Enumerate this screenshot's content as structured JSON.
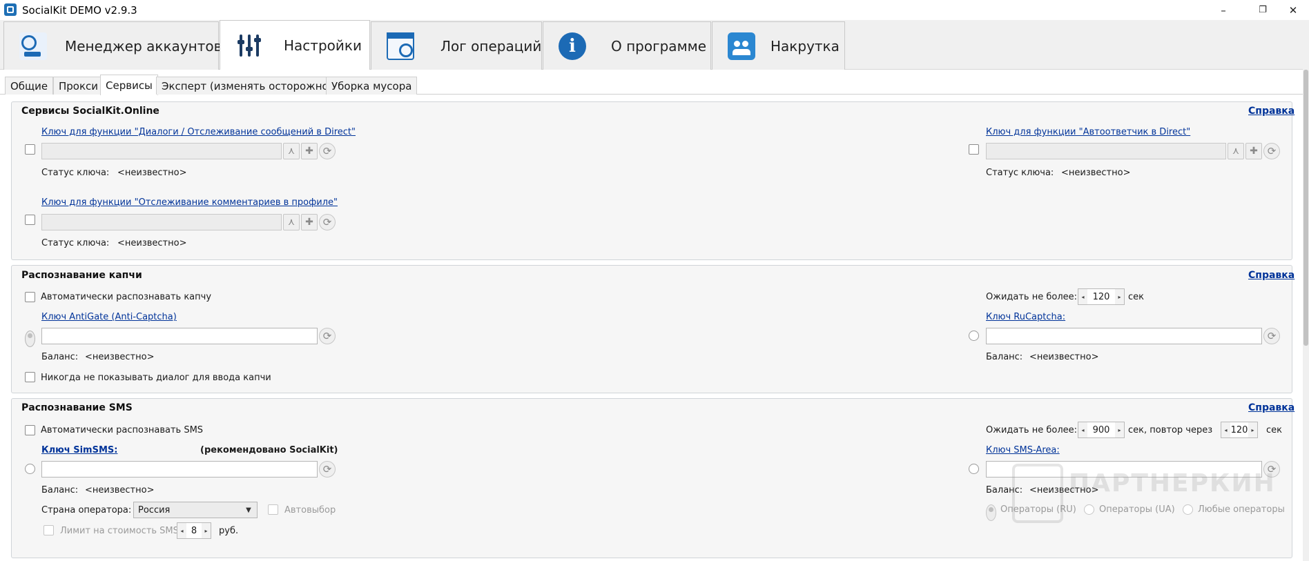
{
  "window": {
    "title": "SocialKit DEMO v2.9.3",
    "min_icon": "–",
    "max_icon": "❐",
    "close_icon": "✕"
  },
  "main_tabs": [
    {
      "label": "Менеджер аккаунтов",
      "icon": "account-manager-icon"
    },
    {
      "label": "Настройки",
      "icon": "settings-sliders-icon",
      "active": true
    },
    {
      "label": "Лог операций",
      "icon": "operations-log-icon"
    },
    {
      "label": "О программе",
      "icon": "info-icon",
      "glyph": "i"
    },
    {
      "label": "Накрутка",
      "icon": "boost-users-icon"
    }
  ],
  "sub_tabs": [
    {
      "label": "Общие"
    },
    {
      "label": "Прокси"
    },
    {
      "label": "Сервисы",
      "active": true
    },
    {
      "label": "Эксперт (изменять осторожно)"
    },
    {
      "label": "Уборка мусора"
    }
  ],
  "services": {
    "title": "Сервисы SocialKit.Online",
    "help": "Справка",
    "dialogs_key": {
      "label": "Ключ для функции \"Диалоги / Отслеживание сообщений в Direct\"",
      "status_label": "Статус ключа:",
      "status_value": "<неизвестно>"
    },
    "autoresponder_key": {
      "label": "Ключ для функции \"Автоответчик в Direct\"",
      "status_label": "Статус ключа:",
      "status_value": "<неизвестно>"
    },
    "comments_key": {
      "label": "Ключ для функции \"Отслеживание комментариев в профиле\"",
      "status_label": "Статус ключа:",
      "status_value": "<неизвестно>"
    }
  },
  "captcha": {
    "title": "Распознавание капчи",
    "help": "Справка",
    "auto_label": "Автоматически распознавать капчу",
    "wait_label": "Ожидать не более:",
    "wait_value": "120",
    "wait_unit": "сек",
    "antigate": {
      "label": "Ключ AntiGate (Anti-Captcha)",
      "balance_label": "Баланс:",
      "balance_value": "<неизвестно>"
    },
    "rucaptcha": {
      "label": "Ключ RuCaptcha:",
      "balance_label": "Баланс:",
      "balance_value": "<неизвестно>"
    },
    "never_show_label": "Никогда не показывать диалог для ввода капчи"
  },
  "sms": {
    "title": "Распознавание SMS",
    "help": "Справка",
    "auto_label": "Автоматически распознавать SMS",
    "wait_label": "Ожидать не более:",
    "wait_value": "900",
    "repeat_label": "сек, повтор через",
    "repeat_value": "120",
    "unit": "сек",
    "simsms": {
      "label": "Ключ SimSMS:",
      "recommended": "(рекомендовано SocialKit)",
      "balance_label": "Баланс:",
      "balance_value": "<неизвестно>"
    },
    "smsarea": {
      "label": "Ключ SMS-Area:",
      "balance_label": "Баланс:",
      "balance_value": "<неизвестно>"
    },
    "country_label": "Страна оператора:",
    "country_value": "Россия",
    "autoselect_label": "Автовыбор",
    "limit_label": "Лимит на стоимость SMS",
    "limit_value": "8",
    "limit_unit": "руб.",
    "operators": [
      {
        "label": "Операторы (RU)",
        "selected": true
      },
      {
        "label": "Операторы (UA)",
        "selected": false
      },
      {
        "label": "Любые операторы",
        "selected": false
      }
    ]
  },
  "watermark": "ПАРТНЕРКИН",
  "glyphs": {
    "spin_left": "◂",
    "spin_right": "▸",
    "dropdown": "▼",
    "add": "✚",
    "refresh": "⟳",
    "share": "⋏"
  }
}
